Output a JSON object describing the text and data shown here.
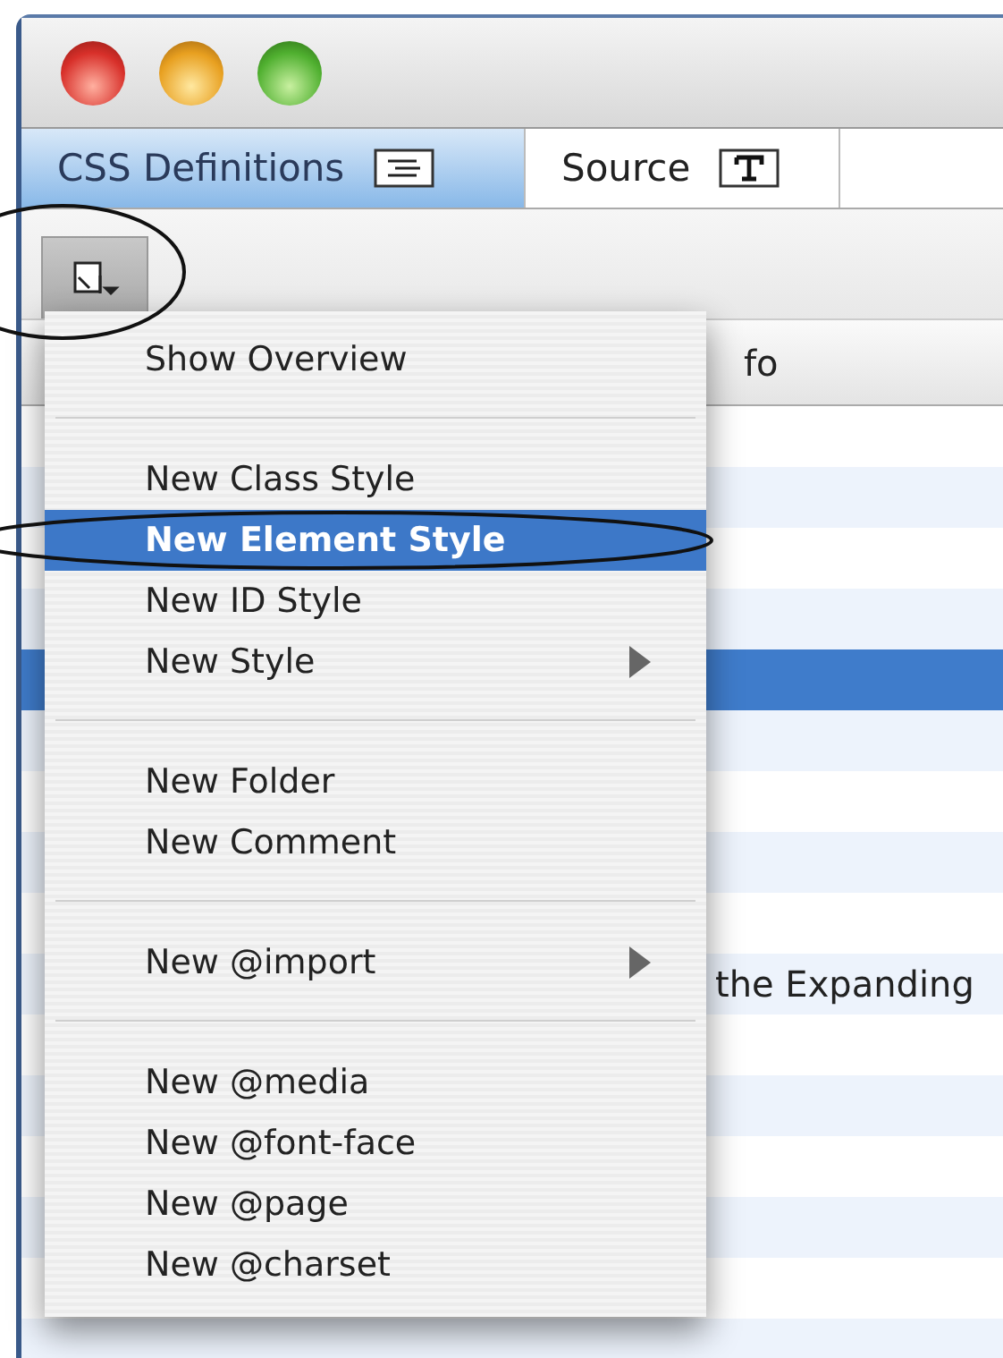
{
  "tabs": [
    {
      "label": "CSS Definitions",
      "selected": true,
      "kind": "lines"
    },
    {
      "label": "Source",
      "selected": false,
      "kind": "text"
    }
  ],
  "toolbar": {
    "menu_button": {
      "pressed": true
    }
  },
  "table": {
    "columns": [
      "fo"
    ],
    "rows": [
      {
        "selected": false
      },
      {
        "selected": false
      },
      {
        "selected": false
      },
      {
        "selected": false
      },
      {
        "selected": true
      },
      {
        "selected": false
      },
      {
        "selected": false
      },
      {
        "selected": false
      },
      {
        "selected": false
      },
      {
        "selected": false,
        "text": "the Expanding"
      },
      {
        "selected": false
      },
      {
        "selected": false
      },
      {
        "selected": false
      },
      {
        "selected": false
      },
      {
        "selected": false
      },
      {
        "selected": false
      }
    ]
  },
  "menu": {
    "groups": [
      [
        {
          "label": "Show Overview",
          "selected": false,
          "submenu": false
        }
      ],
      [
        {
          "label": "New Class Style",
          "selected": false,
          "submenu": false
        },
        {
          "label": "New Element Style",
          "selected": true,
          "submenu": false
        },
        {
          "label": "New ID Style",
          "selected": false,
          "submenu": false
        },
        {
          "label": "New Style",
          "selected": false,
          "submenu": true
        }
      ],
      [
        {
          "label": "New Folder",
          "selected": false,
          "submenu": false
        },
        {
          "label": "New Comment",
          "selected": false,
          "submenu": false
        }
      ],
      [
        {
          "label": "New @import",
          "selected": false,
          "submenu": true
        }
      ],
      [
        {
          "label": "New @media",
          "selected": false,
          "submenu": false
        },
        {
          "label": "New @font-face",
          "selected": false,
          "submenu": false
        },
        {
          "label": "New @page",
          "selected": false,
          "submenu": false
        },
        {
          "label": "New @charset",
          "selected": false,
          "submenu": false
        }
      ]
    ]
  }
}
